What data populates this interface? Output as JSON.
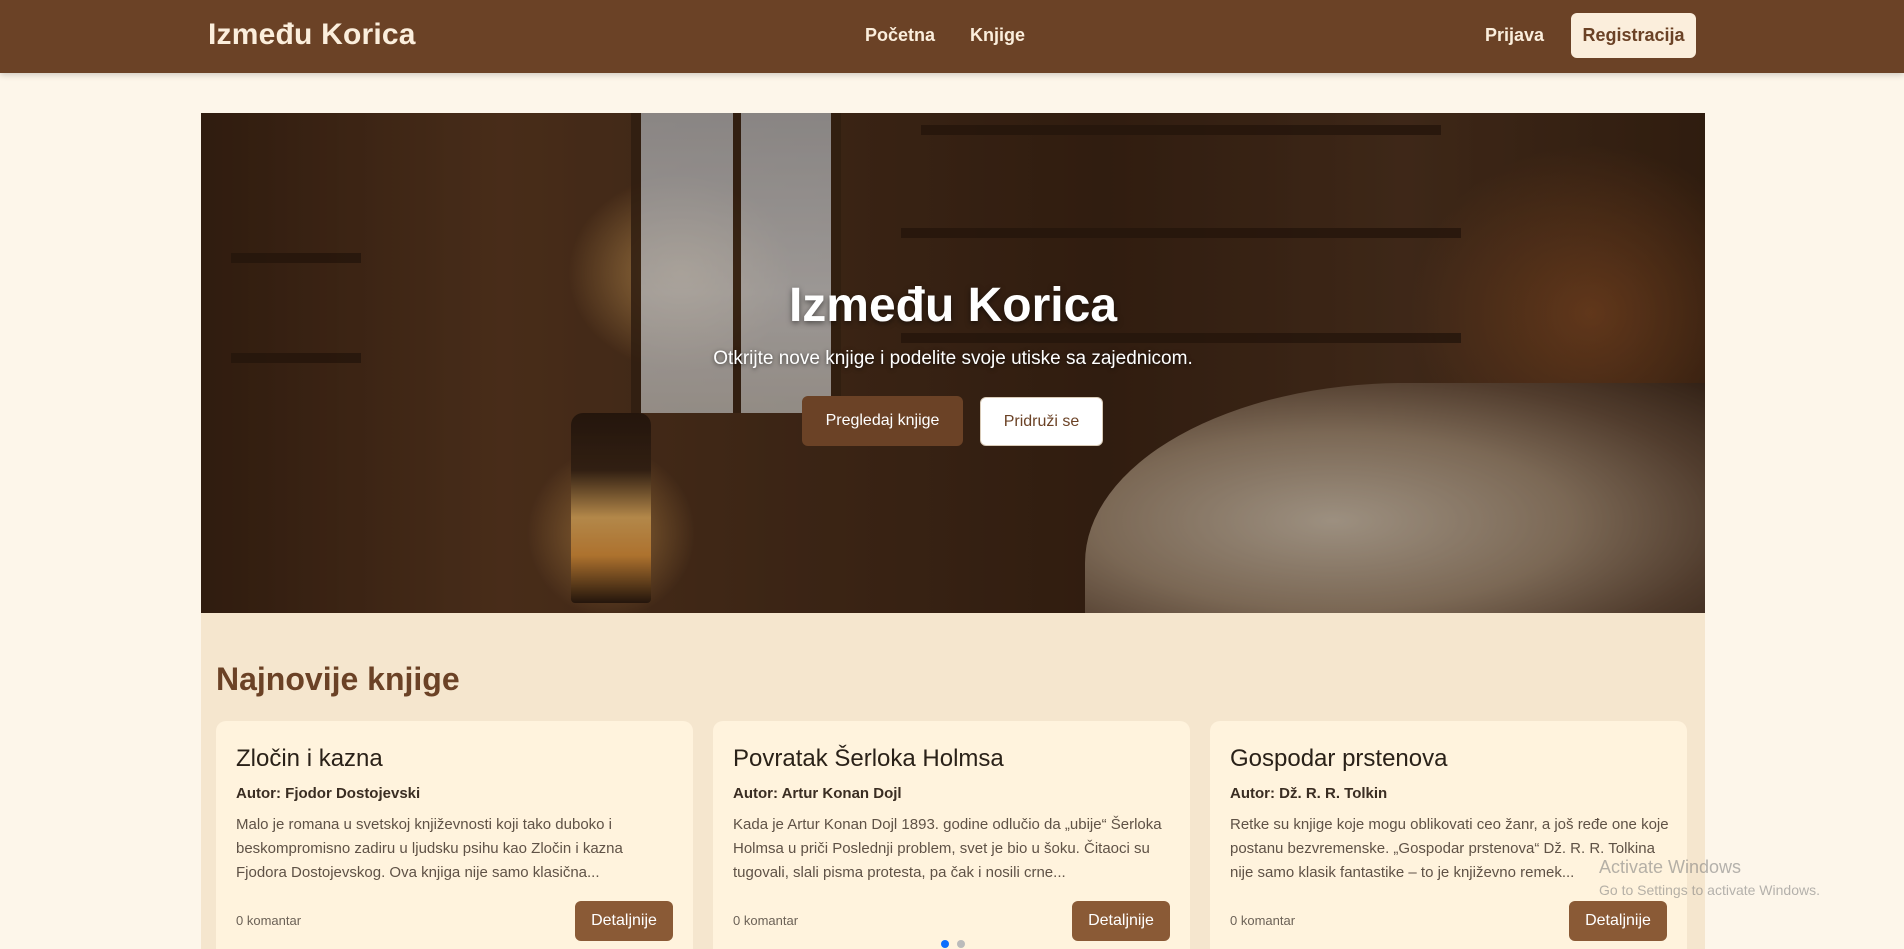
{
  "nav": {
    "brand": "Između Korica",
    "links": [
      "Početna",
      "Knjige"
    ],
    "login": "Prijava",
    "register": "Registracija"
  },
  "hero": {
    "title": "Između Korica",
    "subtitle": "Otkrijte nove knjige i podelite svoje utiske sa zajednicom.",
    "browse_button": "Pregledaj knjige",
    "join_button": "Pridruži se"
  },
  "latest": {
    "title": "Najnovije knjige",
    "books": [
      {
        "title": "Zločin i kazna",
        "author": "Autor: Fjodor Dostojevski",
        "description": "Malo je romana u svetskoj književnosti koji tako duboko i beskompromisno zadiru u ljudsku psihu kao Zločin i kazna Fjodora Dostojevskog. Ova knjiga nije samo klasična...",
        "comments": "0 komantar",
        "details": "Detaljnije"
      },
      {
        "title": "Povratak Šerloka Holmsa",
        "author": "Autor: Artur Konan Dojl",
        "description": "Kada je Artur Konan Dojl 1893. godine odlučio da „ubije“ Šerloka Holmsa u priči Poslednji problem, svet je bio u šoku. Čitaoci su tugovali, slali pisma protesta, pa čak i nosili crne...",
        "comments": "0 komantar",
        "details": "Detaljnije"
      },
      {
        "title": "Gospodar prstenova",
        "author": "Autor: Dž. R. R. Tolkin",
        "description": "Retke su knjige koje mogu oblikovati ceo žanr, a još ređe one koje postanu bezvremenske. „Gospodar prstenova“ Dž. R. R. Tolkina nije samo klasik fantastike – to je književno remek...",
        "comments": "0 komantar",
        "details": "Detaljnije"
      }
    ]
  },
  "carousel": {
    "active_index": 0,
    "count": 2,
    "active_color": "#0d6efd",
    "inactive_color": "#bbbbbb"
  },
  "watermark": {
    "title": "Activate Windows",
    "subtitle": "Go to Settings to activate Windows."
  }
}
